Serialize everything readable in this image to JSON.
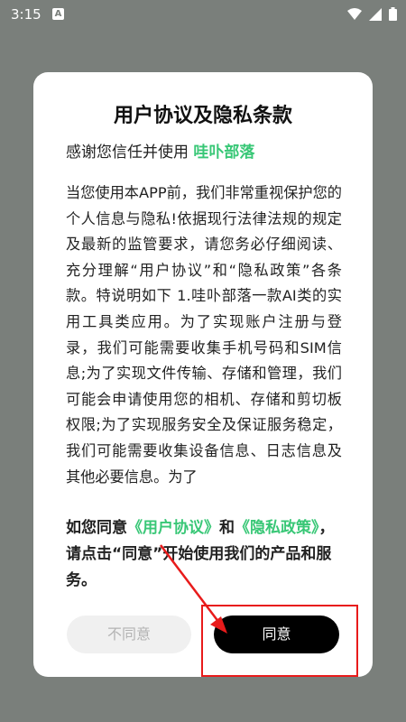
{
  "status_bar": {
    "time": "3:15",
    "notification_letter": "A",
    "icons": [
      "wifi-icon",
      "signal-icon",
      "battery-icon"
    ]
  },
  "dialog": {
    "title": "用户协议及隐私条款",
    "subtitle_prefix": "感谢您信任并使用",
    "app_name": "哇卟部落",
    "body": "当您使用本APP前，我们非常重视保护您的个人信息与隐私!依据现行法律法规的规定及最新的监管要求，请您务必仔细阅读、充分理解“用户协议”和“隐私政策”各条款。特说明如下 1.哇卟部落一款AI类的实用工具类应用。为了实现账户注册与登录，我们可能需要收集手机号码和SIM信息;为了实现文件传输、存储和管理，我们可能会申请使用您的相机、存储和剪切板权限;为了实现服务安全及保证服务稳定，我们可能需要收集设备信息、日志信息及其他必要信息。为了",
    "consent_prefix": "如您同意",
    "user_agreement_link": "《用户协议》",
    "consent_and": "和",
    "privacy_link": "《隐私政策》",
    "consent_suffix": "，请点击“同意”开始使用我们的产品和服务。",
    "disagree_label": "不同意",
    "agree_label": "同意"
  },
  "colors": {
    "accent": "#38c776",
    "annotation": "#e81b1b",
    "overlay": "#7a7f7b"
  }
}
